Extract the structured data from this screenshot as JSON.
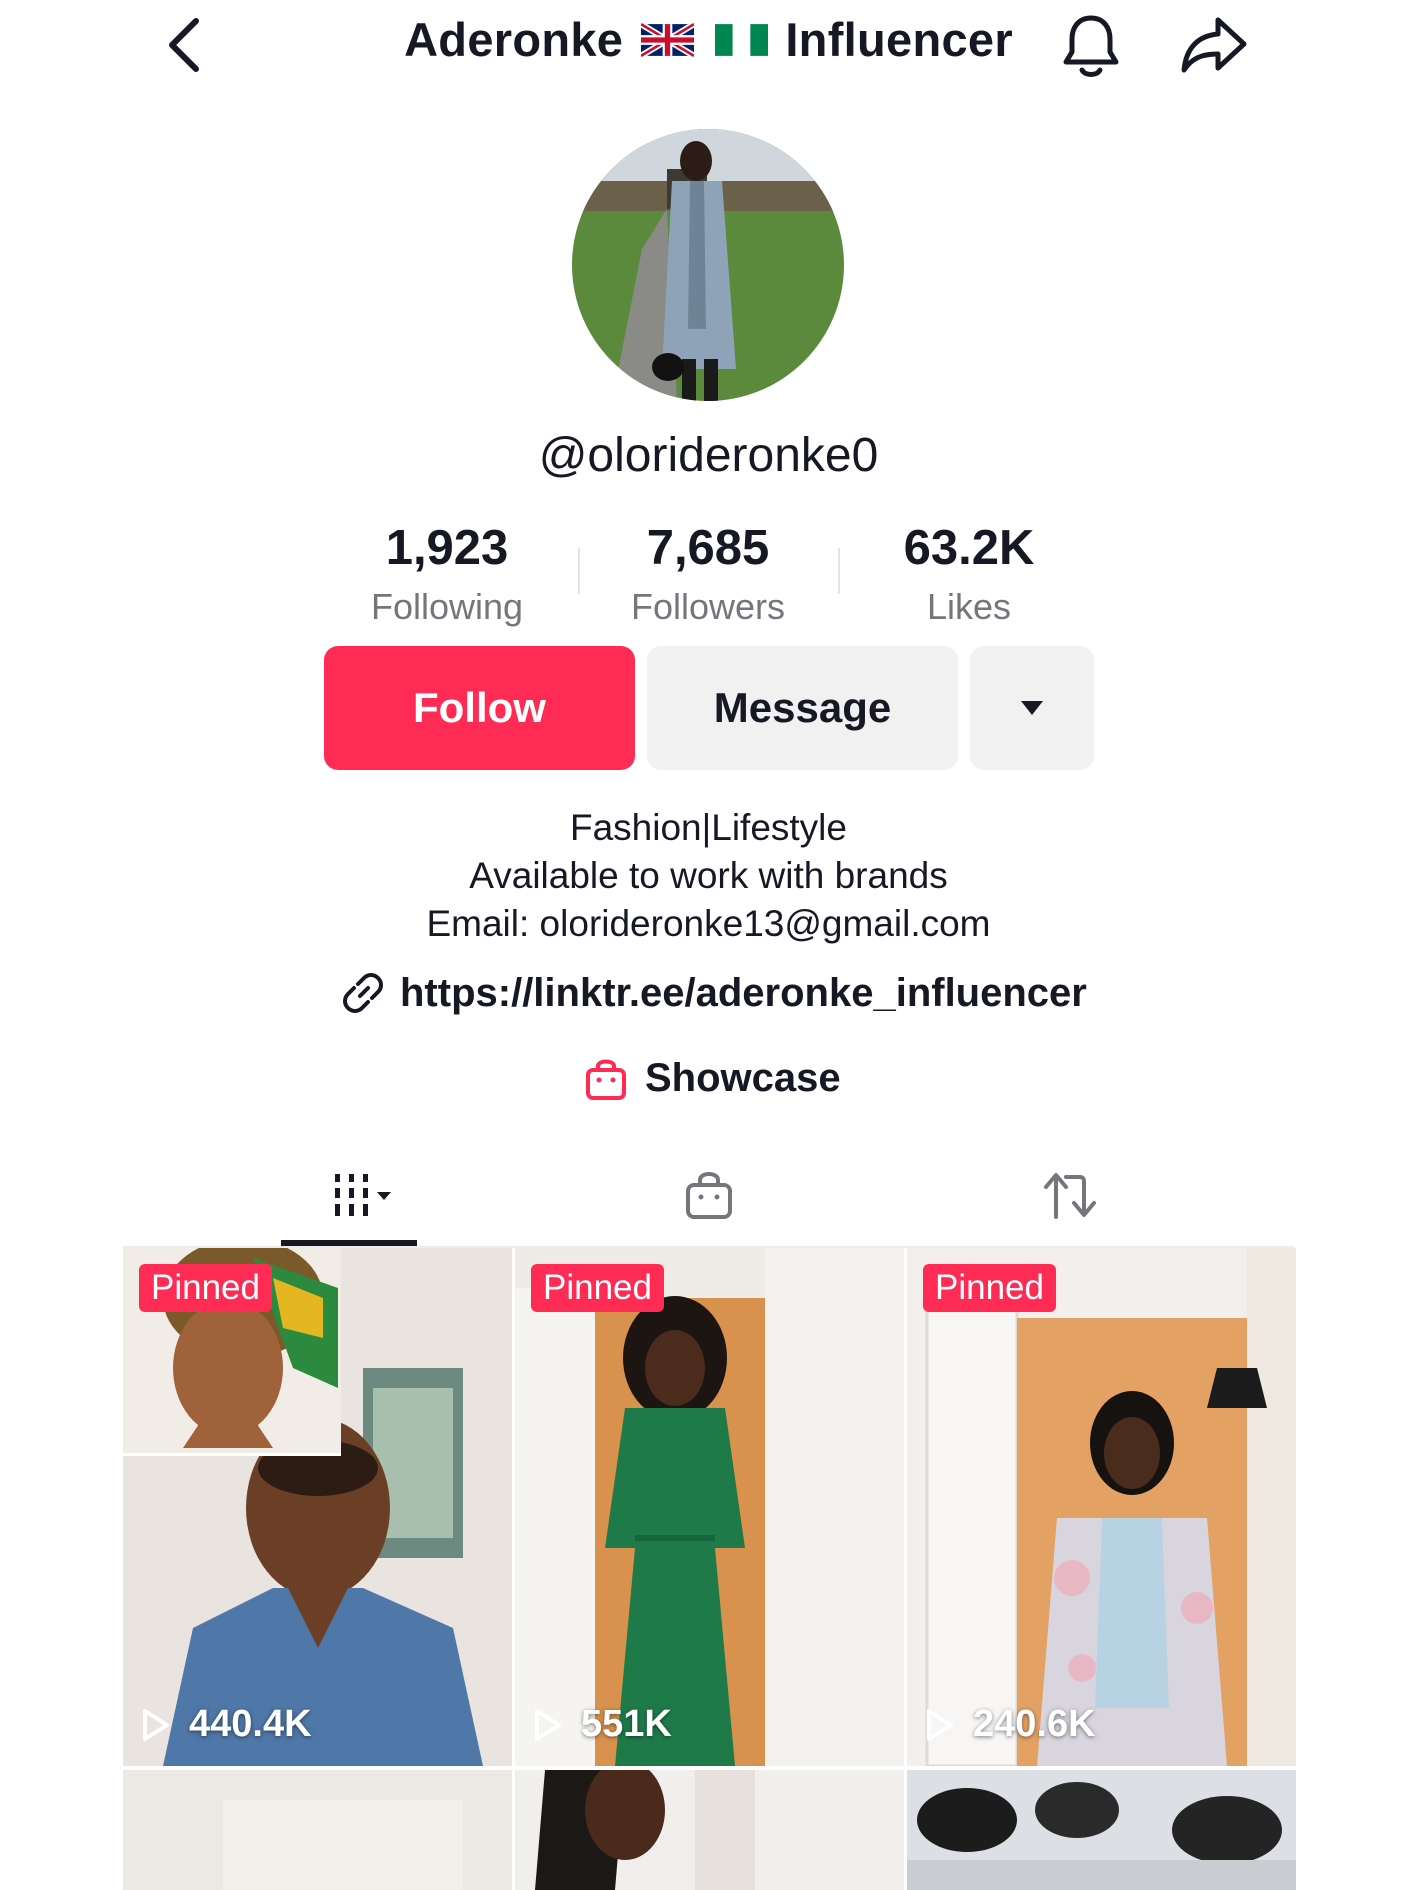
{
  "header": {
    "name_part1": "Aderonke",
    "name_part2": "Influencer",
    "flags": [
      "uk-flag",
      "nigeria-flag"
    ]
  },
  "profile": {
    "username": "@olorideronke0"
  },
  "stats": [
    {
      "value": "1,923",
      "label": "Following"
    },
    {
      "value": "7,685",
      "label": "Followers"
    },
    {
      "value": "63.2K",
      "label": "Likes"
    }
  ],
  "actions": {
    "follow": "Follow",
    "message": "Message"
  },
  "bio": {
    "line1": "Fashion|Lifestyle",
    "line2": "Available to work with brands",
    "line3": "Email: olorideronke13@gmail.com",
    "link": "https://linktr.ee/aderonke_influencer",
    "showcase": "Showcase"
  },
  "tabs": [
    "videos-grid-icon",
    "shop-bag-icon",
    "reposts-icon"
  ],
  "videos": [
    {
      "pinned": "Pinned",
      "views": "440.4K"
    },
    {
      "pinned": "Pinned",
      "views": "551K"
    },
    {
      "pinned": "Pinned",
      "views": "240.6K"
    }
  ],
  "colors": {
    "accent": "#fe2c55",
    "text": "#161823",
    "muted": "#75767c",
    "button_bg": "#f1f1f2"
  }
}
